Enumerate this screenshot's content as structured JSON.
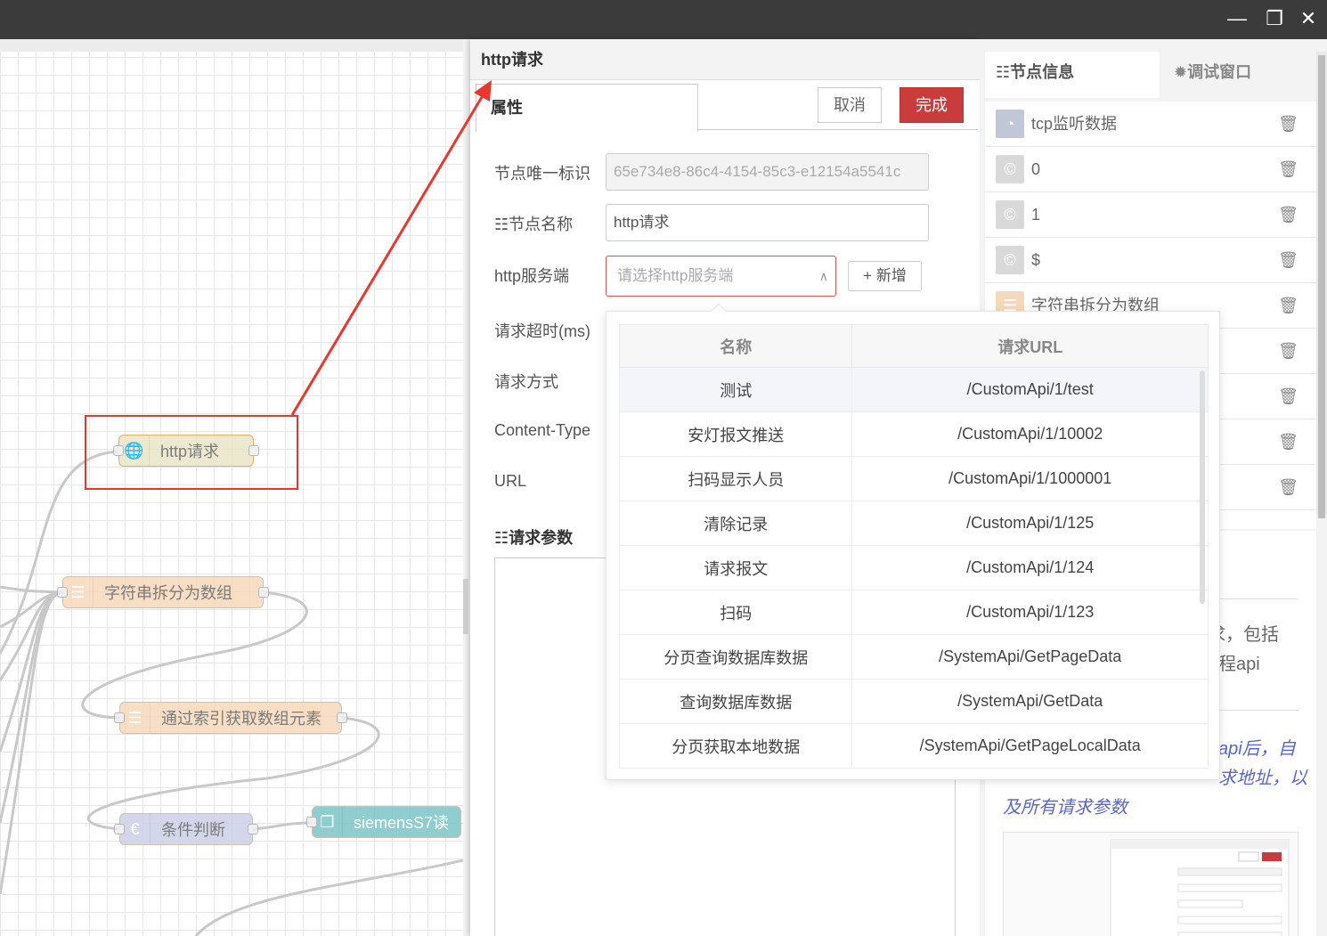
{
  "window": {
    "minimize_icon": "minimize-icon",
    "restore_icon": "restore-icon",
    "close_icon": "close-icon"
  },
  "canvas": {
    "nodes": [
      {
        "label": "http请求",
        "icon": "globe-icon",
        "color": "#e9e6c6"
      },
      {
        "label": "字符串拆分为数组",
        "icon": "split-icon",
        "color": "#f6d9bb"
      },
      {
        "label": "通过索引获取数组元素",
        "icon": "split-icon",
        "color": "#f6d9bb"
      },
      {
        "label": "条件判断",
        "icon": "euro-icon",
        "color": "#cdd1e6"
      },
      {
        "label": "siemensS7读",
        "icon": "chip-icon",
        "color": "#7dc5c7"
      }
    ]
  },
  "editor": {
    "title": "http请求",
    "tab_label": "属性",
    "cancel_label": "取消",
    "done_label": "完成",
    "fields": {
      "node_id_label": "节点唯一标识",
      "node_id_value": "65e734e8-86c4-4154-85c3-e12154a5541c",
      "node_name_label": "节点名称",
      "node_name_value": "http请求",
      "server_label": "http服务端",
      "server_placeholder": "请选择http服务端",
      "add_label": "新增",
      "timeout_label": "请求超时(ms)",
      "method_label": "请求方式",
      "content_type_label": "Content-Type",
      "url_label": "URL",
      "params_label": "请求参数"
    }
  },
  "dropdown": {
    "columns": [
      "名称",
      "请求URL"
    ],
    "rows": [
      {
        "name": "测试",
        "url": "/CustomApi/1/test"
      },
      {
        "name": "安灯报文推送",
        "url": "/CustomApi/1/10002"
      },
      {
        "name": "扫码显示人员",
        "url": "/CustomApi/1/1000001"
      },
      {
        "name": "清除记录",
        "url": "/CustomApi/1/125"
      },
      {
        "name": "请求报文",
        "url": "/CustomApi/1/124"
      },
      {
        "name": "扫码",
        "url": "/CustomApi/1/123"
      },
      {
        "name": "分页查询数据库数据",
        "url": "/SystemApi/GetPageData"
      },
      {
        "name": "查询数据库数据",
        "url": "/SystemApi/GetData"
      },
      {
        "name": "分页获取本地数据",
        "url": "/SystemApi/GetPageLocalData"
      }
    ]
  },
  "sidebar": {
    "tab_info": "节点信息",
    "tab_debug": "调试窗口",
    "items": [
      {
        "label": "tcp监听数据",
        "icon": "rss-icon",
        "color": "#c0c7d8"
      },
      {
        "label": "0",
        "icon": "copyright-icon",
        "color": "#d9d9d9"
      },
      {
        "label": "1",
        "icon": "copyright-icon",
        "color": "#d9d9d9"
      },
      {
        "label": "$",
        "icon": "copyright-icon",
        "color": "#d9d9d9"
      },
      {
        "label": "字符串拆分为数组",
        "icon": "split-icon",
        "color": "#f6d9bb"
      },
      {
        "label": "",
        "icon": "",
        "color": "#ffffff"
      },
      {
        "label": "",
        "icon": "",
        "color": "#ffffff"
      },
      {
        "label": "",
        "icon": "",
        "color": "#ffffff"
      },
      {
        "label": "",
        "icon": "",
        "color": "#ffffff"
      }
    ],
    "info_text_1": "求，包括",
    "info_text_2": "程api",
    "info_italic_1": "api后，自",
    "info_italic_2": "求地址，以",
    "info_italic_3": "及所有请求参数"
  },
  "colors": {
    "accent_red": "#c93c3c",
    "annotation_red": "#e8372c",
    "link_blue": "#5a67c9"
  }
}
